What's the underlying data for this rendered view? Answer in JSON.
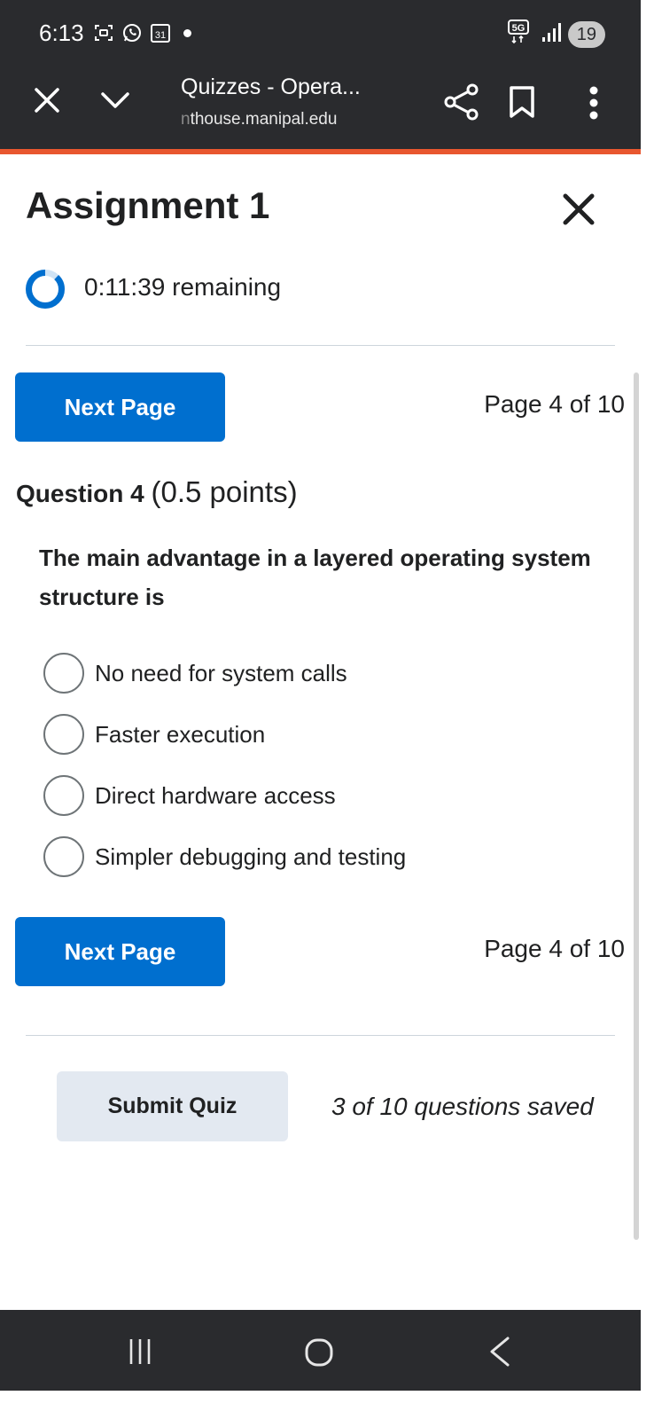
{
  "status_bar": {
    "time": "6:13",
    "calendar_day": "31",
    "network": "5G",
    "battery": "19"
  },
  "browser": {
    "page_title": "Quizzes - Opera...",
    "url_prefix_faded": "n",
    "url_host": "thouse.manipal.edu"
  },
  "quiz": {
    "title": "Assignment 1",
    "timer": "0:11:39 remaining",
    "timer_progress": 0.12,
    "next_page_label": "Next Page",
    "page_indicator": "Page 4 of 10",
    "question": {
      "label": "Question 4",
      "points": "(0.5 points)",
      "text": "The main advantage in a layered operating system structure is",
      "options": [
        "No need for system calls",
        "Faster execution",
        "Direct hardware access",
        "Simpler debugging and testing"
      ]
    },
    "submit_label": "Submit Quiz",
    "saved_status": "3 of 10 questions saved"
  },
  "colors": {
    "primary": "#006fcf",
    "chrome": "#2a2b2e",
    "accent": "#e8572f",
    "secondary_button": "#e3e9f1"
  },
  "icons": [
    "close-icon",
    "chevron-down-icon",
    "share-icon",
    "bookmark-icon",
    "more-icon",
    "timer-icon",
    "recent-apps-icon",
    "home-icon",
    "back-icon"
  ]
}
